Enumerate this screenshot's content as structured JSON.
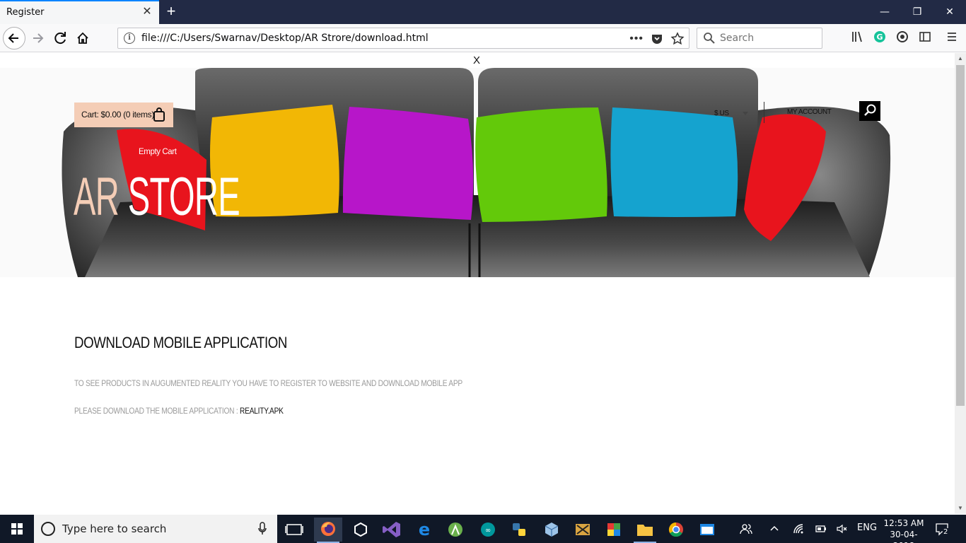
{
  "browser": {
    "tab_title": "Register",
    "tab_close": "✕",
    "new_tab": "+",
    "url": "file:///C:/Users/Swarnav/Desktop/AR Strore/download.html",
    "search_placeholder": "Search",
    "window_controls": {
      "minimize": "—",
      "restore": "❐",
      "close": "✕"
    }
  },
  "page": {
    "close_label": "X",
    "cart": {
      "label": "Cart: $0.00 (0 items)",
      "empty_label": "Empty Cart"
    },
    "logo": {
      "part1": "AR ",
      "part2": "STORE"
    },
    "currency": "$ US",
    "account": "MY ACCOUNT",
    "content": {
      "title": "DOWNLOAD MOBILE APPLICATION",
      "line1": "TO SEE PRODUCTS IN AUGUMENTED REALITY YOU HAVE TO REGISTER TO WEBSITE AND DOWNLOAD MOBILE APP",
      "line2_prefix": "PLEASE DOWNLOAD THE MOBILE APPLICATION : ",
      "line2_link": "REALITY.APK"
    },
    "colors": {
      "accent": "#f4cdb6",
      "pillow_colors": [
        "#e8141d",
        "#f2b705",
        "#b716c9",
        "#63c90a",
        "#15a3cf",
        "#e8141d"
      ]
    }
  },
  "taskbar": {
    "search_placeholder": "Type here to search",
    "tray_lang": "ENG",
    "clock_time": "12:53 AM",
    "clock_date": "30-04-2018",
    "notification_count": "2"
  }
}
